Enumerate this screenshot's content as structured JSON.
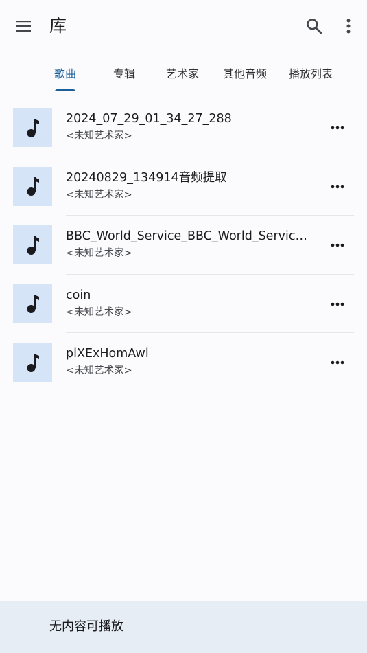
{
  "topbar": {
    "title": "库",
    "menu_icon": "menu-icon",
    "search_icon": "search-icon",
    "more_icon": "more-vert-icon"
  },
  "tabs": [
    {
      "label": "歌曲",
      "active": true
    },
    {
      "label": "专辑",
      "active": false
    },
    {
      "label": "艺术家",
      "active": false
    },
    {
      "label": "其他音频",
      "active": false
    },
    {
      "label": "播放列表",
      "active": false
    }
  ],
  "songs": [
    {
      "title": "2024_07_29_01_34_27_288",
      "artist": "<未知艺术家>"
    },
    {
      "title": "20240829_134914音频提取",
      "artist": "<未知艺术家>"
    },
    {
      "title": "BBC_World_Service_BBC_World_Servic…",
      "artist": "<未知艺术家>"
    },
    {
      "title": "coin",
      "artist": "<未知艺术家>"
    },
    {
      "title": "plXExHomAwl",
      "artist": "<未知艺术家>"
    }
  ],
  "player": {
    "status": "无内容可播放"
  },
  "colors": {
    "accent": "#1a5f9a",
    "thumb_bg": "#d5e4f6",
    "player_bg": "#e6edf5",
    "background": "#fbfbfe"
  }
}
